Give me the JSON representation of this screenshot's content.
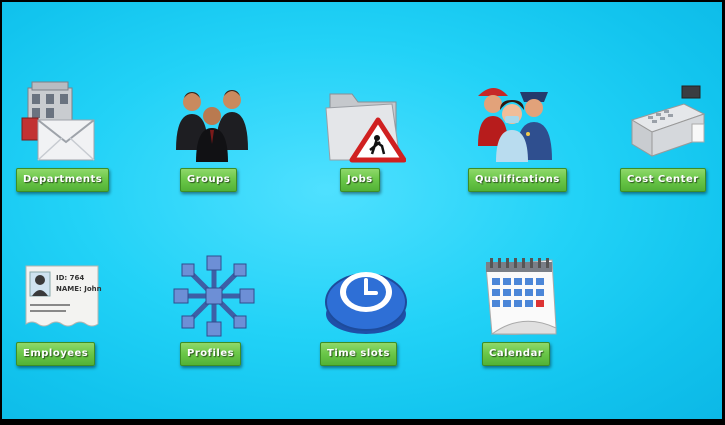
{
  "tiles": [
    {
      "label": "Departments",
      "icon": "building-mail-icon"
    },
    {
      "label": "Groups",
      "icon": "people-group-icon"
    },
    {
      "label": "Jobs",
      "icon": "folder-roadwork-icon"
    },
    {
      "label": "Qualifications",
      "icon": "professionals-icon"
    },
    {
      "label": "Cost Center",
      "icon": "cash-register-icon"
    },
    {
      "label": "Employees",
      "icon": "id-card-icon"
    },
    {
      "label": "Profiles",
      "icon": "network-cubes-icon"
    },
    {
      "label": "Time slots",
      "icon": "clock-button-icon"
    },
    {
      "label": "Calendar",
      "icon": "calendar-icon"
    }
  ],
  "id_card": {
    "line1": "ID: 764",
    "line2": "NAME: John"
  },
  "colors": {
    "background": "#22d2f7",
    "button": "#6cc84a",
    "border": "#000000"
  }
}
